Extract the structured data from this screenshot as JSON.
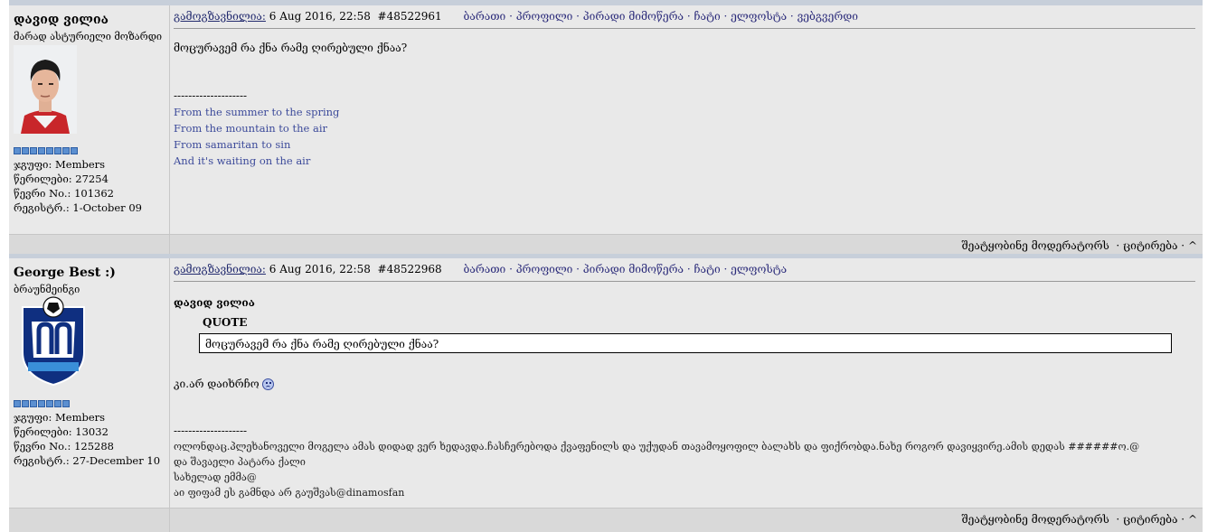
{
  "posts": [
    {
      "author": "დავიდ ვილია",
      "user_title": "მარად ასტურიელი მოზარდი",
      "group": "ჯგუფი: Members",
      "posts_count": "წერილები: 27254",
      "member_no": "წევრი No.: 101362",
      "registered": "რეგისტრ.: 1-October 09",
      "posted_label": "გამოგზავნილია:",
      "date": "6 Aug 2016, 22:58",
      "post_id": "#48522961",
      "nav": [
        "ბარათი",
        "პროფილი",
        "პირადი მიმოწერა",
        "ჩატი",
        "ელფოსტა",
        "ვებგვერდი"
      ],
      "text": "მოცურავემ რა ქნა რამე ღირებული ქნაა?",
      "signature_sep": "--------------------",
      "signature": [
        "From the summer to the spring",
        "From the mountain to the air",
        "From samaritan to sin",
        "And it's waiting on the air"
      ],
      "footer": [
        "შეატყობინე მოდერატორს",
        "ციტირება",
        "^"
      ],
      "pips": 8
    },
    {
      "author": "George Best :)",
      "user_title": "ბრაუნმეინგი",
      "group": "ჯგუფი: Members",
      "posts_count": "წერილები: 13032",
      "member_no": "წევრი No.: 125288",
      "registered": "რეგისტრ.: 27-December 10",
      "posted_label": "გამოგზავნილია:",
      "date": "6 Aug 2016, 22:58",
      "post_id": "#48522968",
      "nav": [
        "ბარათი",
        "პროფილი",
        "პირადი მიმოწერა",
        "ჩატი",
        "ელფოსტა"
      ],
      "quoted_author": "დავიდ ვილია",
      "quote_label": "QUOTE",
      "quote_text": "მოცურავემ რა ქნა რამე ღირებული ქნაა?",
      "text": "კი.არ დაიხრჩო",
      "signature_sep": "--------------------",
      "signature": [
        "ოლონდაც.პლეხანოველი მოგელა ამას დიდად ვერ ხედავდა.ჩასჩერებოდა ქვაფენილს და უქუდან თავამოყოფილ ბალახს და ფიქრობდა.ნახე როგორ დავიყვირე.ამის დედას ######ო.@",
        "და შავაელი პატარა ქალი",
        "სახელად ემმა@",
        "აი ფიფამ ეს გამნდა არ გაუშვას@dinamosfan"
      ],
      "footer": [
        "შეატყობინე მოდერატორს",
        "ციტირება",
        "^"
      ],
      "pips": 7
    }
  ]
}
